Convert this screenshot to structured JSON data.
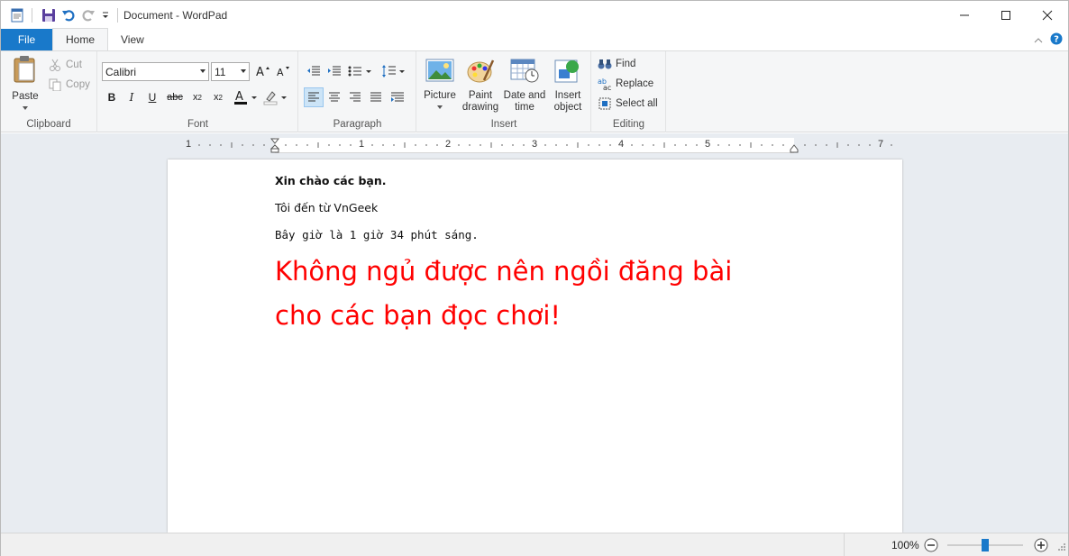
{
  "window": {
    "title": "Document - WordPad"
  },
  "tabs": {
    "file": "File",
    "home": "Home",
    "view": "View"
  },
  "clipboard": {
    "paste": "Paste",
    "cut": "Cut",
    "copy": "Copy",
    "label": "Clipboard"
  },
  "font": {
    "family": "Calibri",
    "size": "11",
    "label": "Font"
  },
  "paragraph": {
    "label": "Paragraph"
  },
  "insert": {
    "picture": "Picture",
    "paint_line1": "Paint",
    "paint_line2": "drawing",
    "datetime_line1": "Date and",
    "datetime_line2": "time",
    "object_line1": "Insert",
    "object_line2": "object",
    "label": "Insert"
  },
  "editing": {
    "find": "Find",
    "replace": "Replace",
    "select_all": "Select all",
    "label": "Editing"
  },
  "ruler": {
    "numbers": [
      "1",
      "1",
      "2",
      "3",
      "4",
      "5",
      "7"
    ]
  },
  "document": {
    "line1": "Xin chào các bạn.",
    "line2": "Tôi đến từ VnGeek",
    "line3": "Bây giờ là 1 giờ 34 phút sáng.",
    "line4": "Không ngủ được nên ngồi đăng bài",
    "line5": "cho các bạn đọc chơi!",
    "accent_color": "#ff0000"
  },
  "status": {
    "zoom": "100%"
  }
}
